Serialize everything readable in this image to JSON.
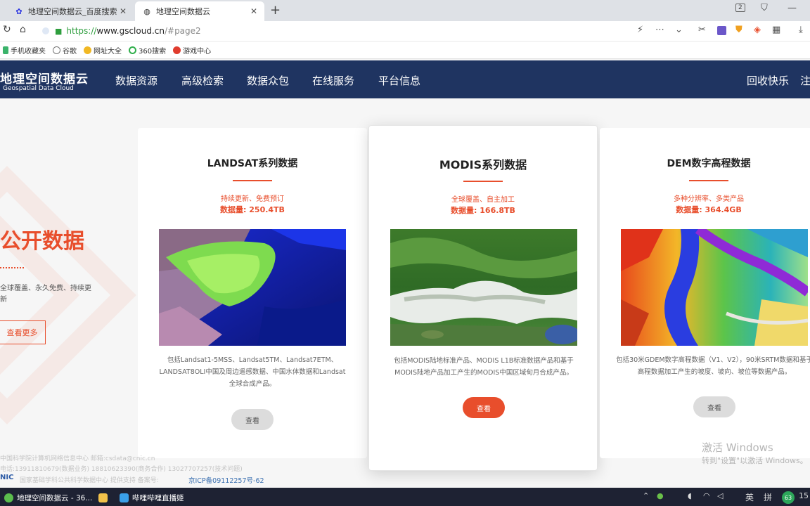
{
  "browser": {
    "tabs": [
      {
        "title": "地理空间数据云_百度搜索",
        "icon": "baidu-paw-icon"
      },
      {
        "title": "地理空间数据云",
        "icon": "globe-icon"
      }
    ],
    "new_tab_glyph": "+",
    "close_glyph": "✕",
    "window_badge": "2",
    "url": {
      "protocol": "https://",
      "host": "www.gscloud.cn",
      "path": "/#page2"
    },
    "bookmarks": [
      "手机收藏夹",
      "谷歌",
      "网址大全",
      "360搜索",
      "游戏中心"
    ]
  },
  "site": {
    "logo_cn": "地理空间数据云",
    "logo_en": "Geospatial Data Cloud",
    "nav": [
      "数据资源",
      "高级检索",
      "数据众包",
      "在线服务",
      "平台信息"
    ],
    "right_nav": [
      "回收快乐",
      "注"
    ]
  },
  "hero": {
    "title": "公开数据",
    "desc": "全球覆盖、永久免费、持续更新",
    "button": "查看更多"
  },
  "cards": [
    {
      "title": "LANDSAT系列数据",
      "subtitle": "持续更新、免费预订",
      "volume": "数据量: 250.4TB",
      "desc": "包括Landsat1-5MSS、Landsat5TM、Landsat7ETM、LANDSAT8OLI中国及周边遥感数据、中国水体数据和Landsat全球合成产品。",
      "button": "查看"
    },
    {
      "title": "MODIS系列数据",
      "subtitle": "全球覆盖、自主加工",
      "volume": "数据量: 166.8TB",
      "desc": "包括MODIS陆地标准产品、MODIS L1B标准数据产品和基于MODIS陆地产品加工产生的MODIS中国区域旬月合成产品。",
      "button": "查看"
    },
    {
      "title": "DEM数字高程数据",
      "subtitle": "多种分辨率、多类产品",
      "volume": "数据量: 364.4GB",
      "desc": "包括30米GDEM数字高程数据（V1、V2），90米SRTM数据和基于高程数据加工产生的坡度、坡向、坡位等数据产品。",
      "button": "查看"
    }
  ],
  "footer": {
    "line1": "中国科学院计算机网络信息中心 邮箱:csdata@cnic.cn",
    "line2": "电话:13911810679(数据业务) 18810623390(商务合作) 13027707257(技术问题)",
    "line3": "国家基础学科公共科学数据中心 提供支持 备案号:",
    "icp": "京ICP备09112257号-62",
    "nic": "NIC"
  },
  "watermark": {
    "line1": "激活 Windows",
    "line2": "转到\"设置\"以激活 Windows。"
  },
  "taskbar": {
    "tasks": [
      "地理空间数据云 - 36...",
      "哔哩哔哩直播姬"
    ],
    "ime": "英",
    "ime2": "拼",
    "badge": "63",
    "clock": "15"
  }
}
